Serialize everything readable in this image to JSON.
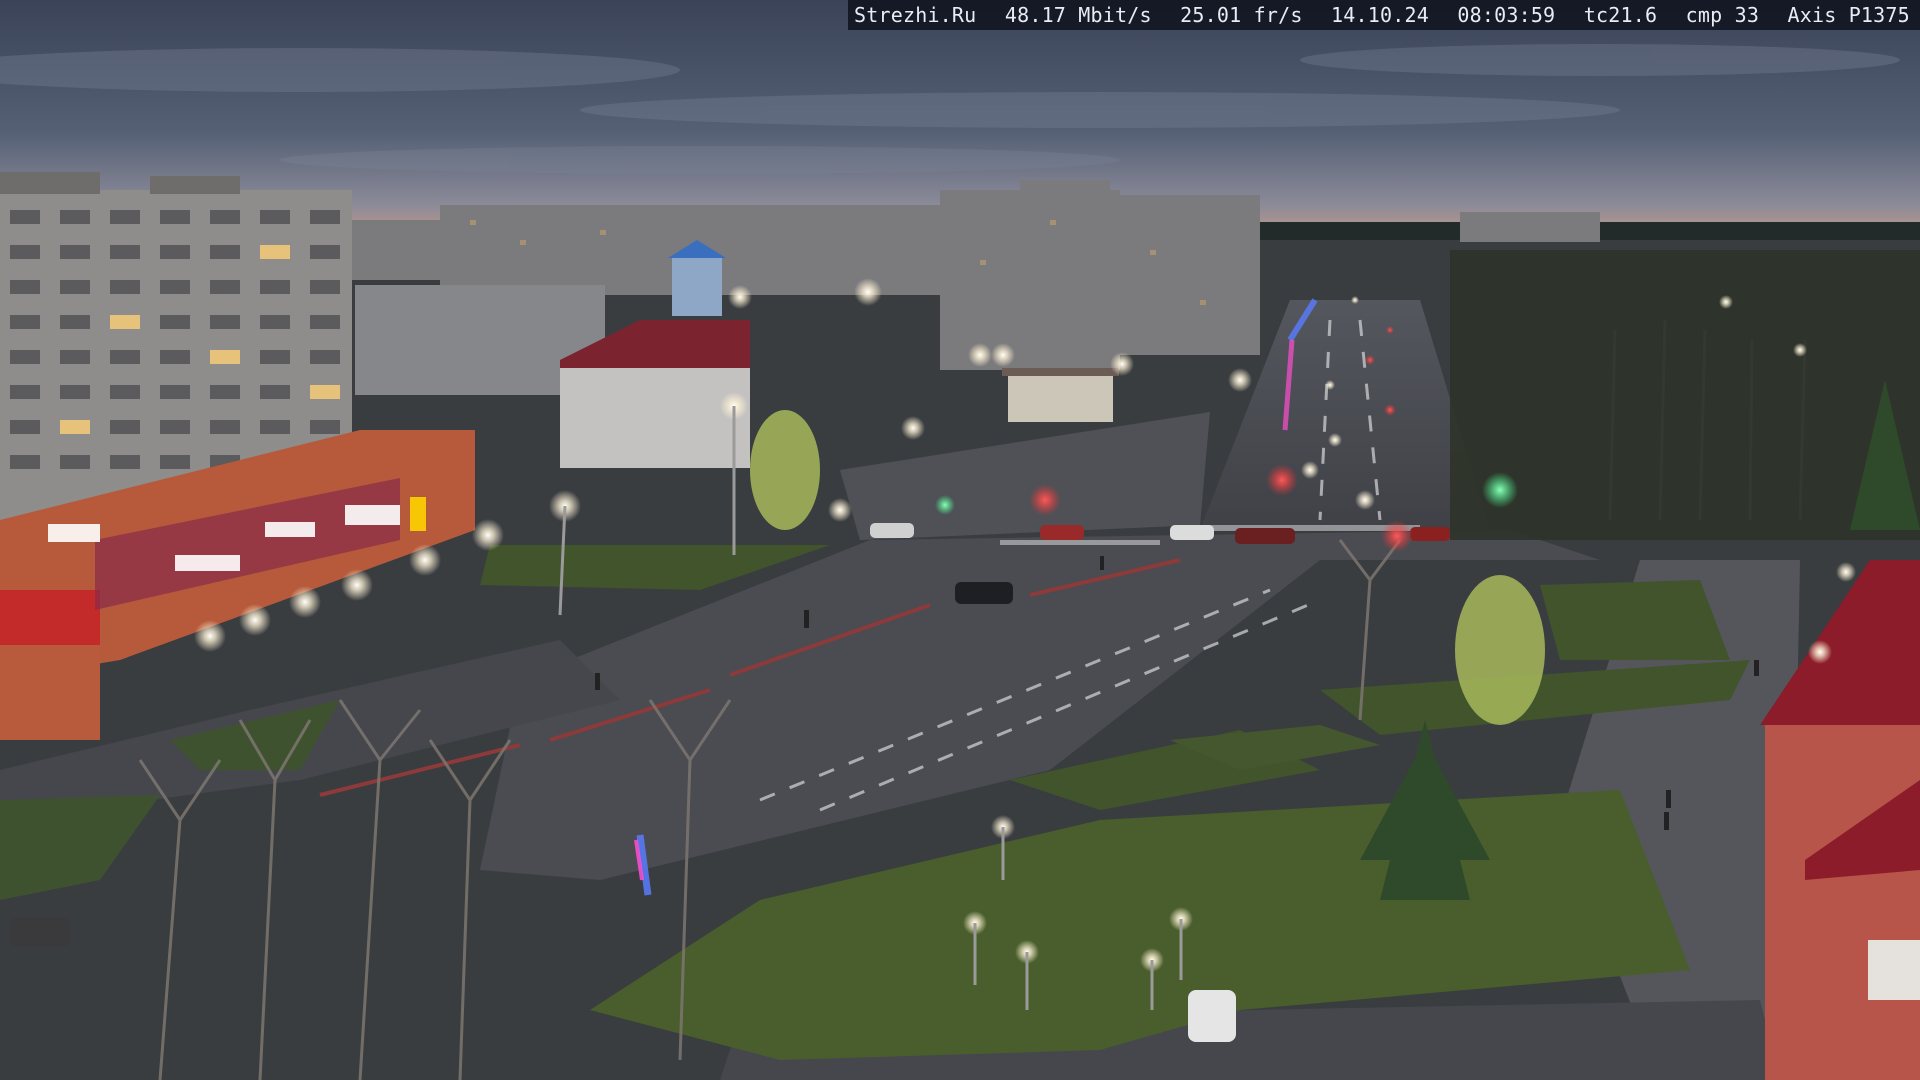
{
  "overlay": {
    "site": "Strezhi.Ru",
    "bitrate": "48.17 Mbit/s",
    "framerate": "25.01 fr/s",
    "date": "14.10.24",
    "time": "08:03:59",
    "tc": "tc21.6",
    "cmp": "cmp 33",
    "camera": "Axis P1375"
  },
  "colors": {
    "sky_top": "#3a4358",
    "sky_horizon": "#c79a8a",
    "asphalt": "#4a4c52",
    "grass": "#41542c",
    "building_brick": "#b65a3b",
    "panel_block": "#8f8d8c",
    "red_roof": "#8c1c2a",
    "lamp_glow": "#fff7e0",
    "traffic_red": "#ff2a2a",
    "traffic_green": "#3cff8a",
    "garland_blue": "#5a7cff",
    "garland_pink": "#ff4fd1"
  }
}
